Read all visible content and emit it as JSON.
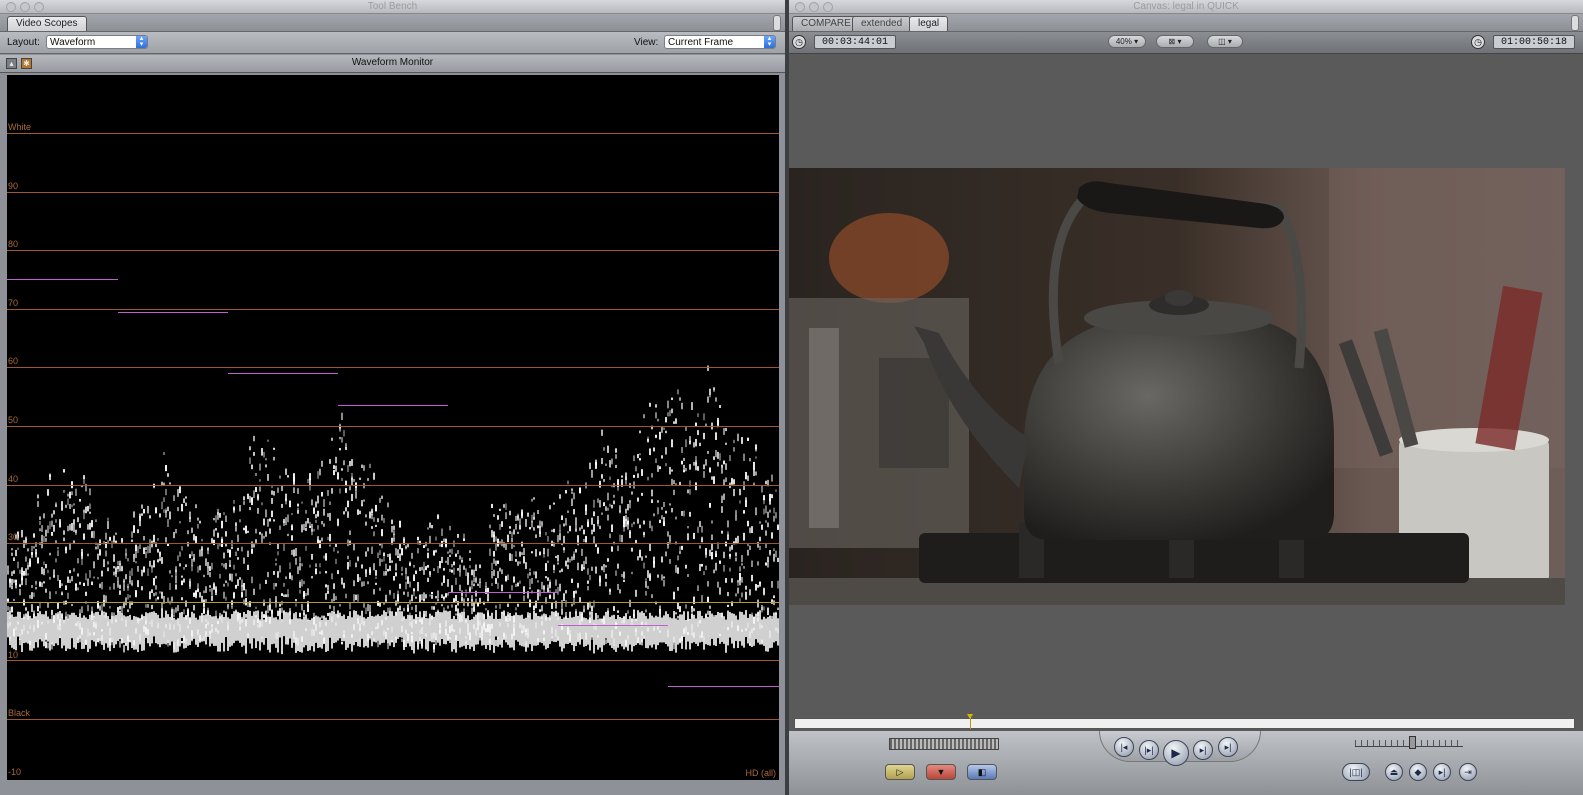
{
  "toolbench": {
    "title": "Tool Bench",
    "tab": "Video Scopes",
    "layout_label": "Layout:",
    "layout_value": "Waveform",
    "view_label": "View:",
    "view_value": "Current Frame",
    "scope_title": "Waveform Monitor",
    "scale": {
      "white": "White",
      "l90": "90",
      "l80": "80",
      "l70": "70",
      "l60": "60",
      "l50": "50",
      "l40": "40",
      "l30": "30",
      "l10": "10",
      "black": "Black",
      "neg10": "-10"
    },
    "hd_label": "HD (all)",
    "grid_color": "#a05a2a",
    "marker_color": "#c060d0"
  },
  "canvas": {
    "title": "Canvas: legal in QUICK",
    "tabs": [
      "COMPARE",
      "extended",
      "legal"
    ],
    "active_tab": "legal",
    "current_timecode": "00:03:44:01",
    "zoom": "40%",
    "duration_timecode": "01:00:50:18"
  }
}
